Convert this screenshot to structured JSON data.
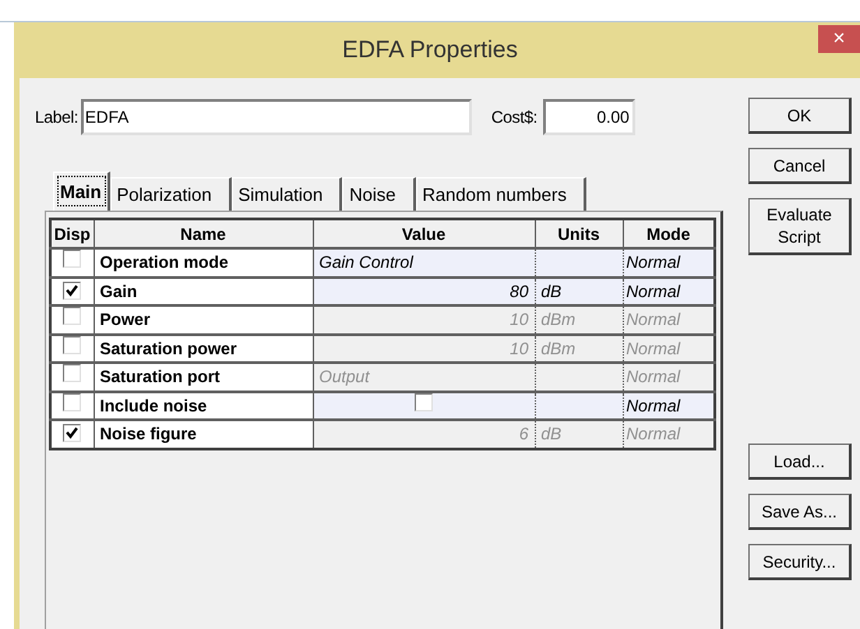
{
  "window": {
    "title": "EDFA Properties",
    "close": "×"
  },
  "label_field": {
    "label": "Label:",
    "value": "EDFA"
  },
  "cost_field": {
    "label": "Cost$:",
    "value": "0.00"
  },
  "tabs": [
    {
      "label": "Main",
      "selected": true
    },
    {
      "label": "Polarization",
      "selected": false
    },
    {
      "label": "Simulation",
      "selected": false
    },
    {
      "label": "Noise",
      "selected": false
    },
    {
      "label": "Random numbers",
      "selected": false
    }
  ],
  "table": {
    "columns": [
      "Disp",
      "Name",
      "Value",
      "Units",
      "Mode"
    ],
    "rows": [
      {
        "disp": false,
        "name": "Operation mode",
        "kind": "text",
        "value": "Gain Control",
        "mode": "Normal",
        "disabled": false
      },
      {
        "disp": true,
        "name": "Gain",
        "kind": "number",
        "value": "80",
        "units": "dB",
        "mode": "Normal",
        "disabled": false
      },
      {
        "disp": false,
        "name": "Power",
        "kind": "number",
        "value": "10",
        "units": "dBm",
        "mode": "Normal",
        "disabled": true
      },
      {
        "disp": false,
        "name": "Saturation power",
        "kind": "number",
        "value": "10",
        "units": "dBm",
        "mode": "Normal",
        "disabled": true
      },
      {
        "disp": false,
        "name": "Saturation port",
        "kind": "text",
        "value": "Output",
        "mode": "Normal",
        "disabled": true
      },
      {
        "disp": false,
        "name": "Include noise",
        "kind": "checkbox",
        "checked": false,
        "mode": "Normal",
        "disabled": false
      },
      {
        "disp": true,
        "name": "Noise figure",
        "kind": "number",
        "value": "6",
        "units": "dB",
        "mode": "Normal",
        "disabled": true
      }
    ]
  },
  "buttons_top": [
    "OK",
    "Cancel",
    "Evaluate Script"
  ],
  "buttons_bottom": [
    "Load...",
    "Save As...",
    "Security..."
  ]
}
